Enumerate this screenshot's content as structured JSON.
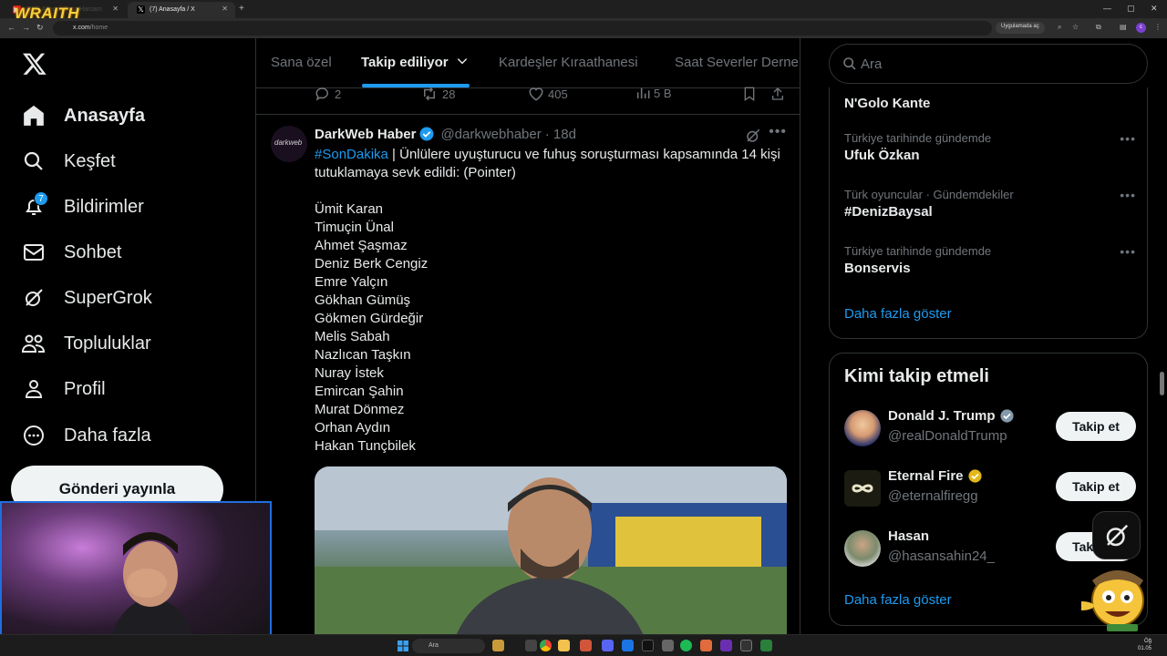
{
  "browser": {
    "tabs": [
      {
        "label": "(205) Ailecek Para Harcam",
        "active": false
      },
      {
        "label": "(7) Anasayfa / X",
        "active": true
      }
    ],
    "streamer_logo": "WRAITH",
    "url_host": "x.com",
    "url_path": "/home",
    "open_in_app": "Uygulamada aç"
  },
  "sidebar": {
    "items": [
      {
        "label": "Anasayfa",
        "icon": "home-icon",
        "bold": true
      },
      {
        "label": "Keşfet",
        "icon": "search-icon"
      },
      {
        "label": "Bildirimler",
        "icon": "bell-icon",
        "badge": "7"
      },
      {
        "label": "Sohbet",
        "icon": "mail-icon"
      },
      {
        "label": "SuperGrok",
        "icon": "grok-icon"
      },
      {
        "label": "Topluluklar",
        "icon": "communities-icon"
      },
      {
        "label": "Profil",
        "icon": "person-icon"
      },
      {
        "label": "Daha fazla",
        "icon": "more-circle-icon"
      }
    ],
    "post_button": "Gönderi yayınla"
  },
  "feed_tabs": {
    "items": [
      "Sana özel",
      "Takip ediliyor",
      "Kardeşler Kıraathanesi",
      "Saat Severler Derne"
    ],
    "active_index": 1
  },
  "prev_tweet_actions": {
    "replies": "2",
    "reposts": "28",
    "likes": "405",
    "views": "5 B"
  },
  "tweet": {
    "name": "DarkWeb Haber",
    "handle": "@darkwebhaber",
    "time": "· 18d",
    "avatar_text": "darkweb",
    "hashtag": "#SonDakika",
    "text": " | Ünlülere uyuşturucu ve fuhuş soruşturması kapsamında 14 kişi tutuklamaya sevk edildi: (Pointer)",
    "names": [
      "Ümit Karan",
      "Timuçin Ünal",
      "Ahmet Şaşmaz",
      "Deniz Berk Cengiz",
      "Emre Yalçın",
      "Gökhan Gümüş",
      "Gökmen Gürdeğir",
      "Melis Sabah",
      "Nazlıcan Taşkın",
      "Nuray İstek",
      "Emircan Şahin",
      "Murat Dönmez",
      "Orhan Aydın",
      "Hakan Tunçbilek"
    ]
  },
  "right": {
    "search_placeholder": "Ara",
    "top_trend": "N'Golo Kante",
    "trends": [
      {
        "context": "Türkiye tarihinde gündemde",
        "title": "Ufuk Özkan"
      },
      {
        "context": "Türk oyuncular · Gündemdekiler",
        "title": "#DenizBaysal"
      },
      {
        "context": "Türkiye tarihinde gündemde",
        "title": "Bonservis"
      }
    ],
    "trends_show_more": "Daha fazla göster",
    "who_to_follow_title": "Kimi takip etmeli",
    "suggestions": [
      {
        "name": "Donald J. Trump",
        "handle": "@realDonaldTrump",
        "verified": "gray",
        "button": "Takip et"
      },
      {
        "name": "Eternal Fire",
        "handle": "@eternalfiregg",
        "verified": "gold",
        "button": "Takip et"
      },
      {
        "name": "Hasan",
        "handle": "@hasansahin24_",
        "verified": "none",
        "button": "Takip et"
      }
    ],
    "follow_show_more": "Daha fazla göster"
  },
  "taskbar": {
    "search_label": "Ara",
    "clock_line1": "Öğ",
    "clock_line2": "01.05"
  },
  "colors": {
    "accent": "#1d9bf0",
    "background": "#000000",
    "border": "#2f3336",
    "muted_text": "#71767b"
  }
}
